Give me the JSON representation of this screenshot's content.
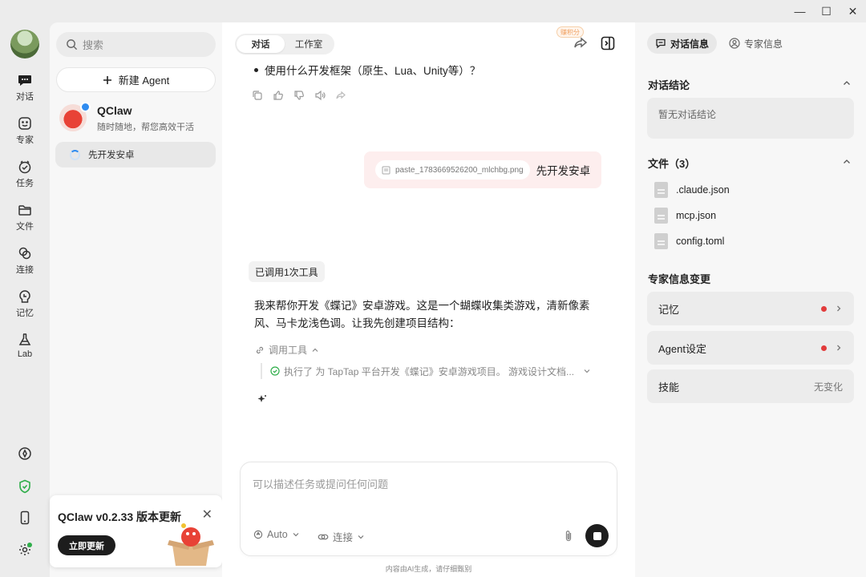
{
  "window": {
    "minimize": "—",
    "maximize": "☐",
    "close": "✕"
  },
  "rail": {
    "items": [
      {
        "label": "对话",
        "icon": "chat-icon"
      },
      {
        "label": "专家",
        "icon": "smile-icon"
      },
      {
        "label": "任务",
        "icon": "task-icon"
      },
      {
        "label": "文件",
        "icon": "folder-icon"
      },
      {
        "label": "连接",
        "icon": "link-icon"
      },
      {
        "label": "记忆",
        "icon": "memory-icon"
      },
      {
        "label": "Lab",
        "icon": "flask-icon"
      }
    ]
  },
  "sidebar": {
    "search_placeholder": "搜索",
    "new_agent": "新建 Agent",
    "agent": {
      "name": "QClaw",
      "subtitle": "随时随地，帮您高效干活"
    },
    "conversation": "先开发安卓"
  },
  "update": {
    "title": "QClaw v0.2.33 版本更新",
    "button": "立即更新",
    "close": "✕"
  },
  "main": {
    "tabs": [
      "对话",
      "工作室"
    ],
    "points_tag": "赚积分",
    "bullet": "使用什么开发框架（原生、Lua、Unity等）？",
    "user_file": "paste_1783669526200_mlchbg.png",
    "user_text": "先开发安卓",
    "tool_pill": "已调用1次工具",
    "reply": "我来帮你开发《蝶记》安卓游戏。这是一个蝴蝶收集类游戏，清新像素风、马卡龙浅色调。让我先创建项目结构：",
    "tool_toggle": "调用工具",
    "tool_exec": "执行了 为 TapTap 平台开发《蝶记》安卓游戏项目。 游戏设计文档...",
    "composer_placeholder": "可以描述任务或提问任何问题",
    "mode": "Auto",
    "connect": "连接",
    "disclaimer": "内容由AI生成，请仔细甄别"
  },
  "right": {
    "tabs": [
      "对话信息",
      "专家信息"
    ],
    "summary_title": "对话结论",
    "summary_empty": "暂无对话结论",
    "files_title": "文件（3）",
    "files": [
      ".claude.json",
      "mcp.json",
      "config.toml"
    ],
    "expert_changes_title": "专家信息变更",
    "rows": [
      {
        "label": "记忆"
      },
      {
        "label": "Agent设定"
      },
      {
        "label": "技能",
        "status": "无变化"
      }
    ]
  }
}
